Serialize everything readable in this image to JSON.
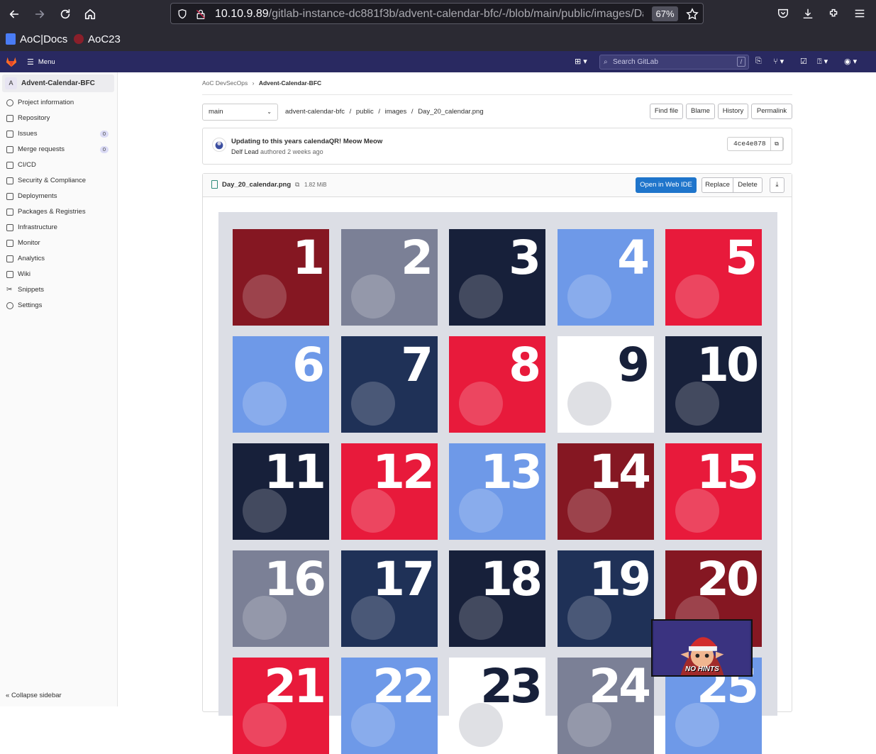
{
  "browser": {
    "url_host": "10.10.9.89",
    "url_path": "/gitlab-instance-dc881f3b/advent-calendar-bfc/-/blob/main/public/images/Da",
    "zoom": "67%",
    "bookmarks": [
      "AoC|Docs",
      "AoC23"
    ]
  },
  "header": {
    "menu_label": "Menu",
    "search_placeholder": "Search GitLab",
    "search_shortcut": "/"
  },
  "sidebar": {
    "project_initial": "A",
    "project_name": "Advent-Calendar-BFC",
    "items": [
      {
        "label": "Project information",
        "icon": "info-icon"
      },
      {
        "label": "Repository",
        "icon": "repository-icon"
      },
      {
        "label": "Issues",
        "icon": "issues-icon",
        "badge": "0"
      },
      {
        "label": "Merge requests",
        "icon": "merge-request-icon",
        "badge": "0"
      },
      {
        "label": "CI/CD",
        "icon": "rocket-icon"
      },
      {
        "label": "Security & Compliance",
        "icon": "shield-icon"
      },
      {
        "label": "Deployments",
        "icon": "deployments-icon"
      },
      {
        "label": "Packages & Registries",
        "icon": "package-icon"
      },
      {
        "label": "Infrastructure",
        "icon": "infrastructure-icon"
      },
      {
        "label": "Monitor",
        "icon": "monitor-icon"
      },
      {
        "label": "Analytics",
        "icon": "chart-icon"
      },
      {
        "label": "Wiki",
        "icon": "book-icon"
      },
      {
        "label": "Snippets",
        "icon": "snippet-icon"
      },
      {
        "label": "Settings",
        "icon": "gear-icon"
      }
    ],
    "collapse_label": "Collapse sidebar"
  },
  "breadcrumb": {
    "group": "AoC DevSecOps",
    "project": "Advent-Calendar-BFC"
  },
  "repo": {
    "branch": "main",
    "path": [
      "advent-calendar-bfc",
      "public",
      "images",
      "Day_20_calendar.png"
    ],
    "buttons": {
      "find_file": "Find file",
      "blame": "Blame",
      "history": "History",
      "permalink": "Permalink"
    }
  },
  "commit": {
    "message": "Updating to this years calendaQR! Meow Meow",
    "author": "Delf Lead",
    "authored": "authored 2 weeks ago",
    "sha": "4ce4e878"
  },
  "file": {
    "name": "Day_20_calendar.png",
    "size": "1.82 MiB",
    "buttons": {
      "open_ide": "Open in Web IDE",
      "replace": "Replace",
      "delete": "Delete"
    }
  },
  "calendar": {
    "tiles": [
      {
        "n": "1",
        "bg": "#851722",
        "fg": "#ffffff"
      },
      {
        "n": "2",
        "bg": "#7b8096",
        "fg": "#ffffff"
      },
      {
        "n": "3",
        "bg": "#17203a",
        "fg": "#ffffff"
      },
      {
        "n": "4",
        "bg": "#6e99e8",
        "fg": "#ffffff"
      },
      {
        "n": "5",
        "bg": "#e81a3b",
        "fg": "#ffffff"
      },
      {
        "n": "6",
        "bg": "#6e99e8",
        "fg": "#ffffff"
      },
      {
        "n": "7",
        "bg": "#1f3157",
        "fg": "#ffffff"
      },
      {
        "n": "8",
        "bg": "#e81a3b",
        "fg": "#ffffff"
      },
      {
        "n": "9",
        "bg": "#ffffff",
        "fg": "#17203a"
      },
      {
        "n": "10",
        "bg": "#17203a",
        "fg": "#ffffff"
      },
      {
        "n": "11",
        "bg": "#17203a",
        "fg": "#ffffff"
      },
      {
        "n": "12",
        "bg": "#e81a3b",
        "fg": "#ffffff"
      },
      {
        "n": "13",
        "bg": "#6e99e8",
        "fg": "#ffffff"
      },
      {
        "n": "14",
        "bg": "#851722",
        "fg": "#ffffff"
      },
      {
        "n": "15",
        "bg": "#e81a3b",
        "fg": "#ffffff"
      },
      {
        "n": "16",
        "bg": "#7b8096",
        "fg": "#ffffff"
      },
      {
        "n": "17",
        "bg": "#1f3157",
        "fg": "#ffffff"
      },
      {
        "n": "18",
        "bg": "#17203a",
        "fg": "#ffffff"
      },
      {
        "n": "19",
        "bg": "#1f3157",
        "fg": "#ffffff"
      },
      {
        "n": "20",
        "bg": "#851722",
        "fg": "#ffffff"
      },
      {
        "n": "21",
        "bg": "#e81a3b",
        "fg": "#ffffff"
      },
      {
        "n": "22",
        "bg": "#6e99e8",
        "fg": "#ffffff"
      },
      {
        "n": "23",
        "bg": "#ffffff",
        "fg": "#17203a"
      },
      {
        "n": "24",
        "bg": "#7b8096",
        "fg": "#ffffff"
      },
      {
        "n": "25",
        "bg": "#6e99e8",
        "fg": "#ffffff"
      }
    ]
  },
  "hint_popup": {
    "label": "NO HINTS"
  }
}
